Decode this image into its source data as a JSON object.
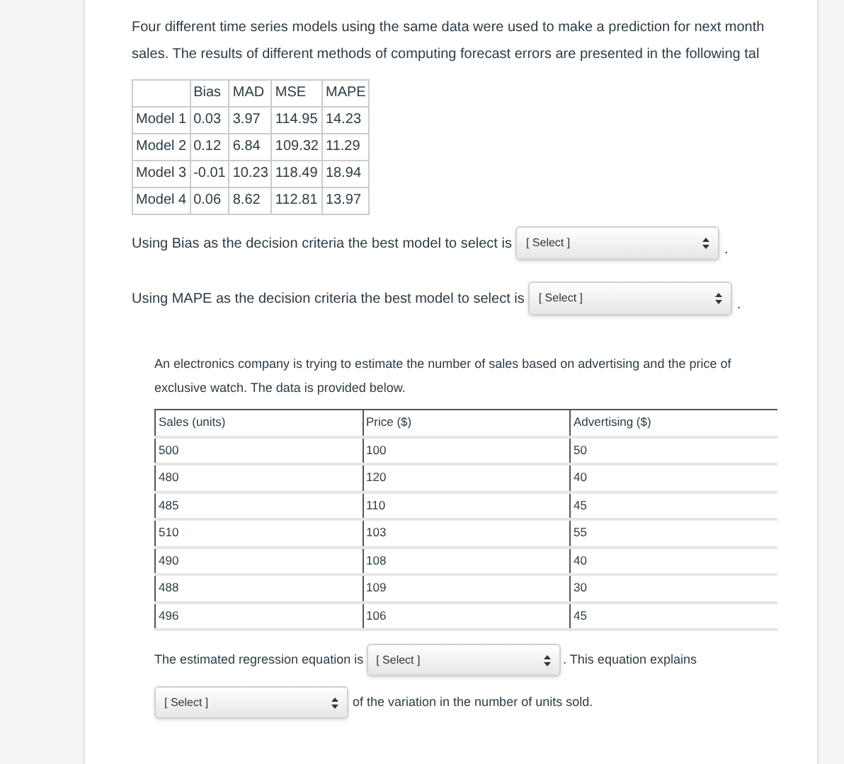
{
  "question_1": {
    "intro_lines": [
      "Four different time series models using the same data were used to make a prediction for next month",
      "sales. The results of different methods of computing forecast errors are presented in the following tal"
    ],
    "table": {
      "columns": [
        "",
        "Bias",
        "MAD",
        "MSE",
        "MAPE"
      ],
      "rows": [
        [
          "Model 1",
          "0.03",
          "3.97",
          "114.95",
          "14.23"
        ],
        [
          "Model 2",
          "0.12",
          "6.84",
          "109.32",
          "11.29"
        ],
        [
          "Model 3",
          "-0.01",
          "10.23",
          "118.49",
          "18.94"
        ],
        [
          "Model 4",
          "0.06",
          "8.62",
          "112.81",
          "13.97"
        ]
      ]
    },
    "prompts": [
      {
        "text": "Using Bias as the decision criteria the best model to select is",
        "dropdown": "[ Select ]",
        "after": "."
      },
      {
        "text": "Using MAPE as the decision criteria the best model to select is",
        "dropdown": "[ Select ]",
        "after": "."
      }
    ]
  },
  "question_2": {
    "intro": "An electronics company is trying to estimate the number of sales based on advertising and the price of exclusive watch. The data is provided below.",
    "table": {
      "columns": [
        "Sales (units)",
        "Price ($)",
        "Advertising ($)"
      ],
      "rows": [
        [
          "500",
          "100",
          "50"
        ],
        [
          "480",
          "120",
          "40"
        ],
        [
          "485",
          "110",
          "45"
        ],
        [
          "510",
          "103",
          "55"
        ],
        [
          "490",
          "108",
          "40"
        ],
        [
          "488",
          "109",
          "30"
        ],
        [
          "496",
          "106",
          "45"
        ]
      ]
    },
    "sentence_1": {
      "text": "The estimated regression equation is",
      "dropdown": "[ Select ]",
      "after": ". This equation explains"
    },
    "sentence_2": {
      "dropdown": "[ Select ]",
      "after": "of the variation in the number of units sold."
    }
  }
}
